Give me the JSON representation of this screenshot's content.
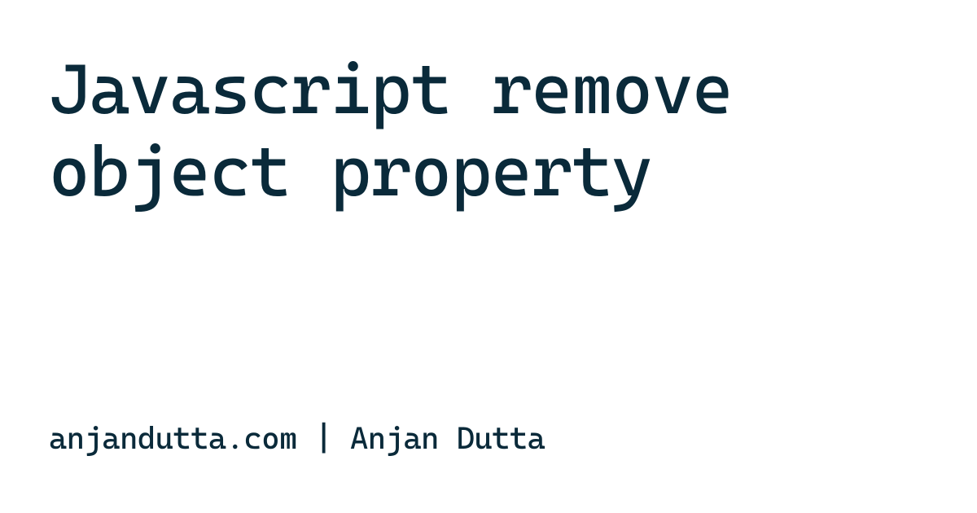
{
  "header": {
    "title": "Javascript remove object property"
  },
  "footer": {
    "byline": "anjandutta.com | Anjan Dutta"
  }
}
